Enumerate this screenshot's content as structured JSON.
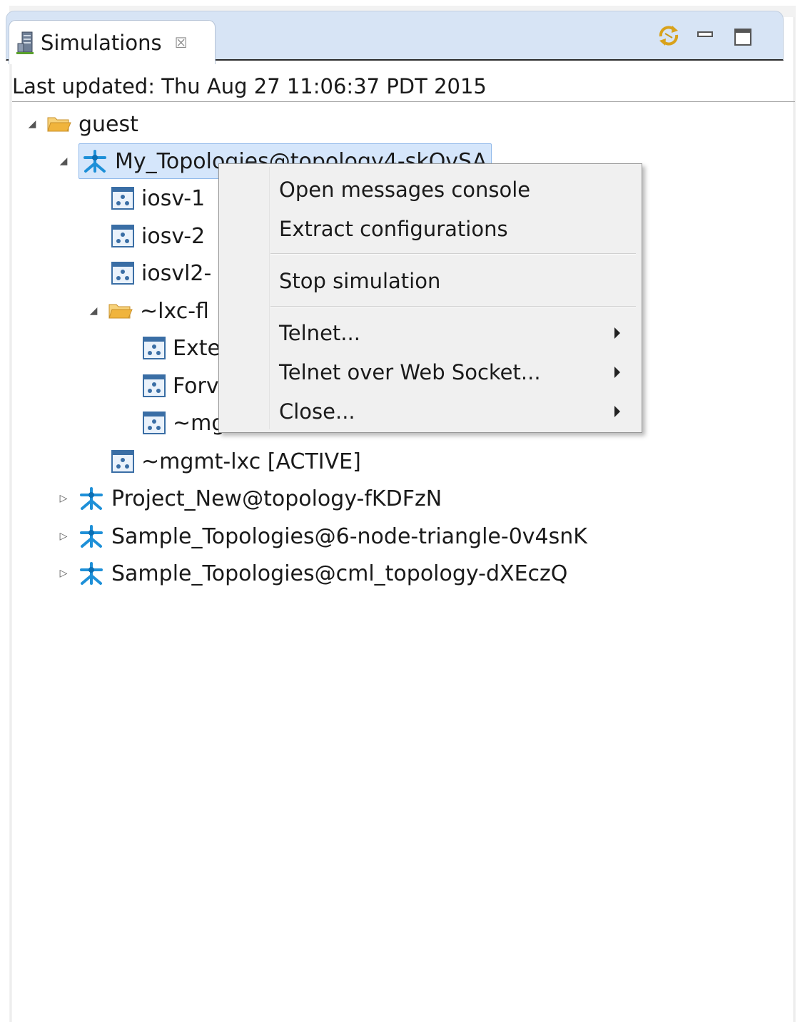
{
  "view": {
    "tab_title": "Simulations",
    "tab_close_glyph": "☒",
    "tab_icon": "server-icon",
    "tools": [
      "sync-icon",
      "minimize-icon",
      "maximize-icon"
    ]
  },
  "status": {
    "last_updated": "Last updated: Thu Aug 27 11:06:37 PDT 2015"
  },
  "tree": {
    "guest": "guest",
    "my_topologies": "My_Topologies@topology4-skQvSA",
    "iosv1": "iosv-1",
    "iosv2": "iosv-2",
    "iosvl2": "iosvl2-",
    "lxc_folder": "~lxc-fl",
    "ext": "Exte",
    "forw": "Forv",
    "mg": "~mg",
    "mgmt_lxc": "~mgmt-lxc  [ACTIVE]",
    "project_new": "Project_New@topology-fKDFzN",
    "sample1": "Sample_Topologies@6-node-triangle-0v4snK",
    "sample2": "Sample_Topologies@cml_topology-dXEczQ"
  },
  "context_menu": {
    "open_console": "Open messages console",
    "extract_configs": "Extract configurations",
    "stop_sim": "Stop simulation",
    "telnet": "Telnet...",
    "telnet_ws": "Telnet over Web Socket...",
    "close": "Close..."
  },
  "colors": {
    "tab_bar": "#d7e4f5",
    "selection": "#d5e6fb",
    "topology_icon": "#1e90d8",
    "folder_icon": "#f0b43c"
  }
}
